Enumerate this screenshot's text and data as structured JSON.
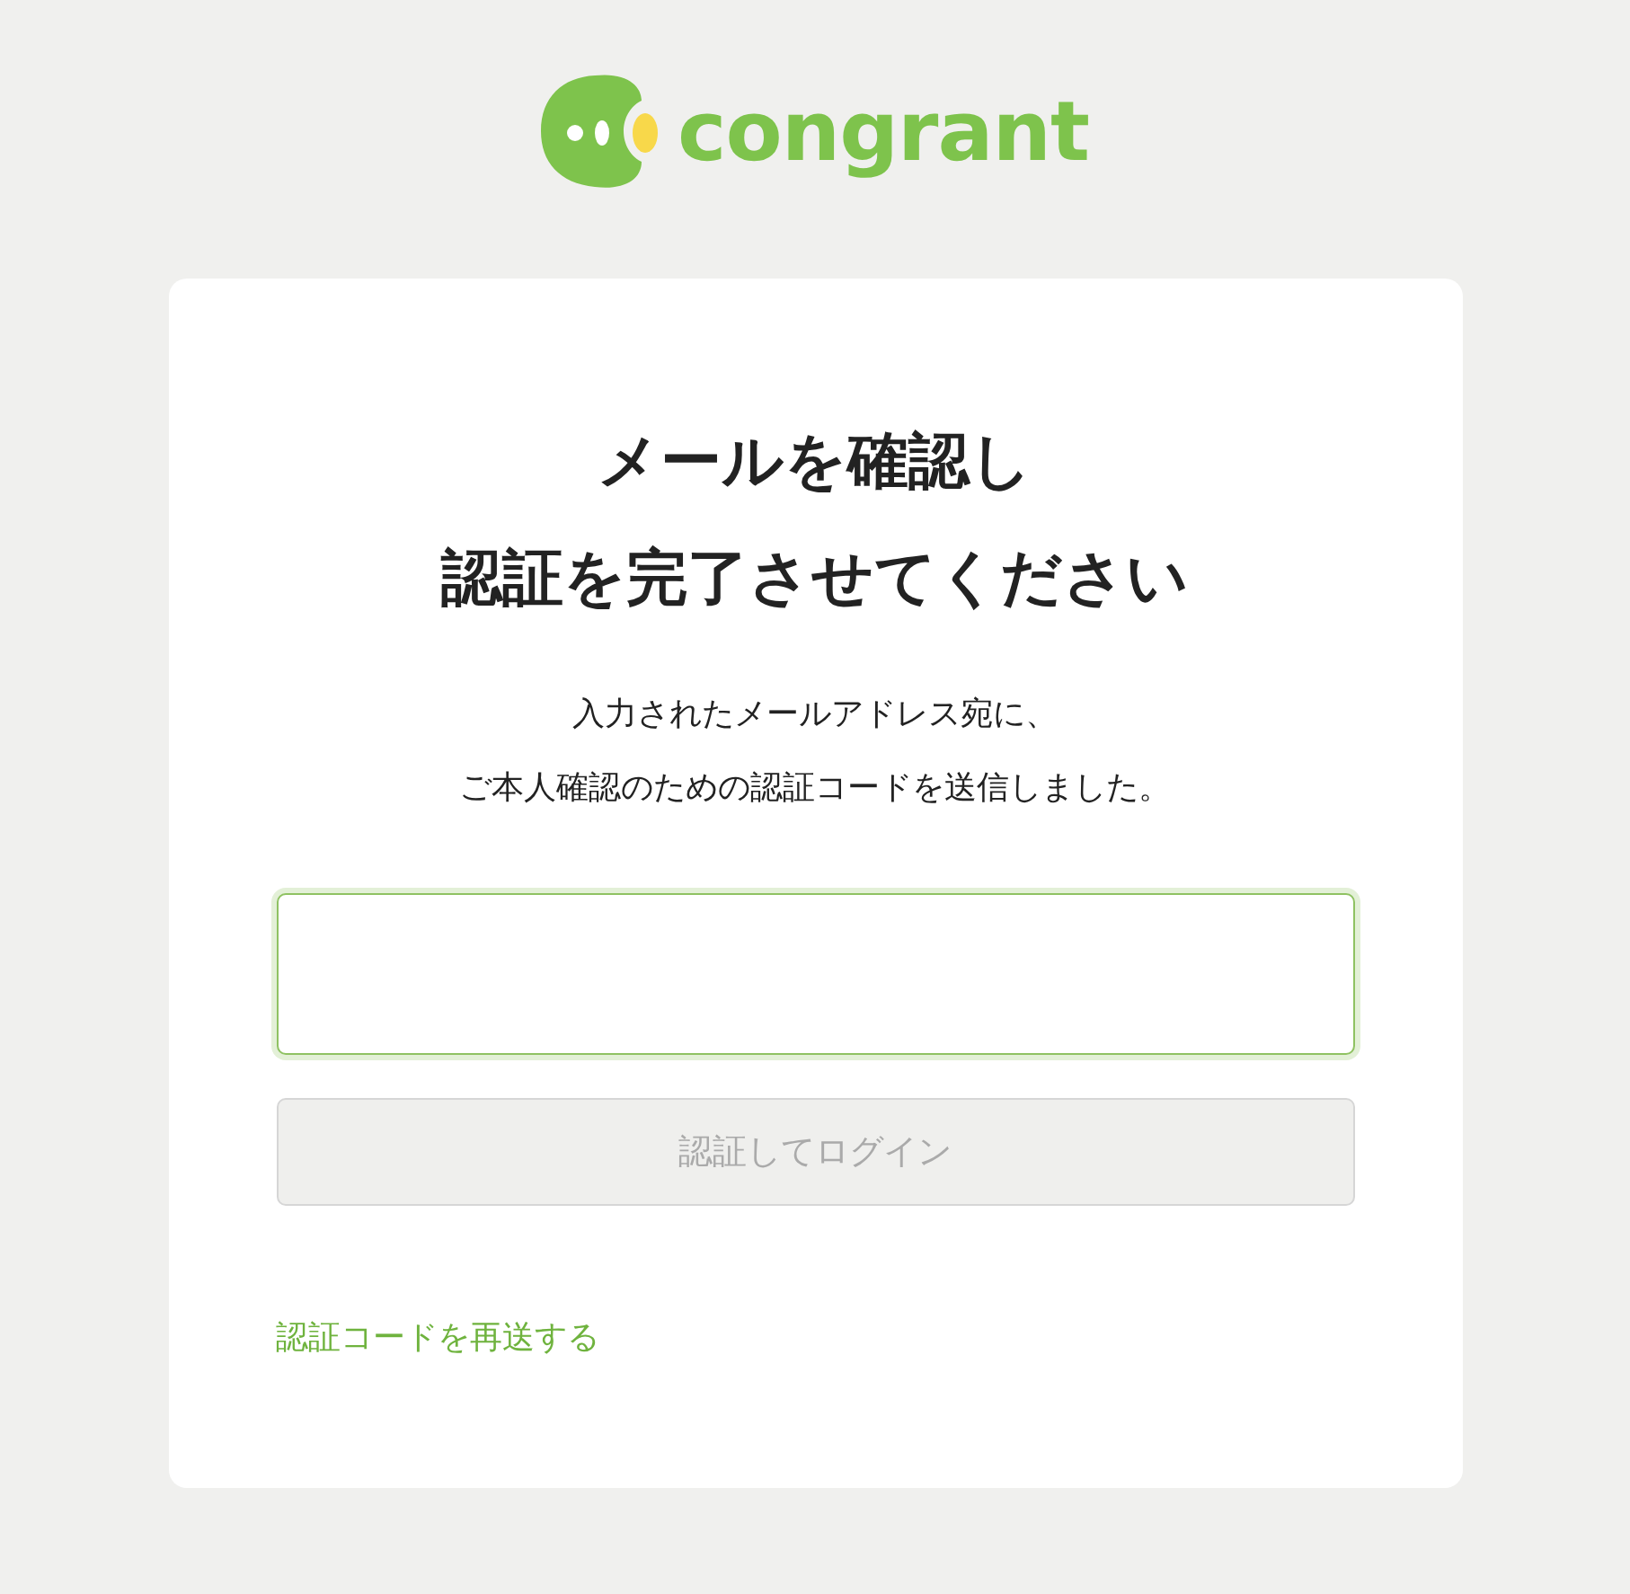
{
  "logo": {
    "text": "congrant"
  },
  "heading": [
    "メールを確認し",
    "認証を完了させてください"
  ],
  "message": [
    "入力されたメールアドレス宛に、",
    "ご本人確認のための認証コードを送信しました。"
  ],
  "code_field": {
    "focused": true
  },
  "submit_button": {
    "label": "認証してログイン",
    "disabled": true
  },
  "resend_link": {
    "label": "認証コードを再送する"
  }
}
